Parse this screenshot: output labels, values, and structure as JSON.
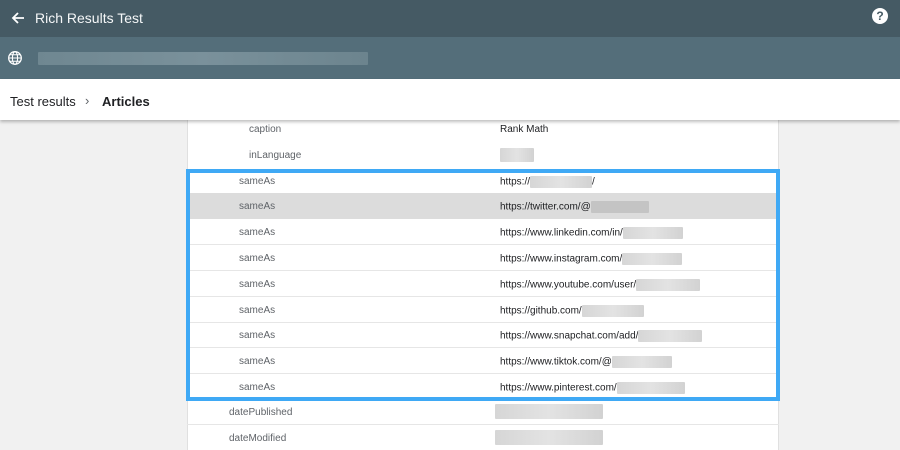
{
  "header": {
    "title": "Rich Results Test",
    "help_label": "?"
  },
  "breadcrumb": {
    "parent": "Test results",
    "separator": "›",
    "current": "Articles"
  },
  "rows": [
    {
      "key": "caption",
      "value": "Rank Math"
    },
    {
      "key": "inLanguage",
      "value": ""
    },
    {
      "key": "sameAs",
      "value": "https://"
    },
    {
      "key": "sameAs",
      "value": "https://twitter.com/@"
    },
    {
      "key": "sameAs",
      "value": "https://www.linkedin.com/in/"
    },
    {
      "key": "sameAs",
      "value": "https://www.instagram.com/"
    },
    {
      "key": "sameAs",
      "value": "https://www.youtube.com/user/"
    },
    {
      "key": "sameAs",
      "value": "https://github.com/"
    },
    {
      "key": "sameAs",
      "value": "https://www.snapchat.com/add/"
    },
    {
      "key": "sameAs",
      "value": "https://www.tiktok.com/@"
    },
    {
      "key": "sameAs",
      "value": "https://www.pinterest.com/"
    },
    {
      "key": "datePublished",
      "value": ""
    },
    {
      "key": "dateModified",
      "value": ""
    }
  ],
  "colors": {
    "topbar": "#455a64",
    "urlbar": "#546e7a",
    "highlight": "#3fa9f5"
  },
  "icons": {
    "back": "arrow-left",
    "globe": "globe",
    "help": "question-circle"
  }
}
